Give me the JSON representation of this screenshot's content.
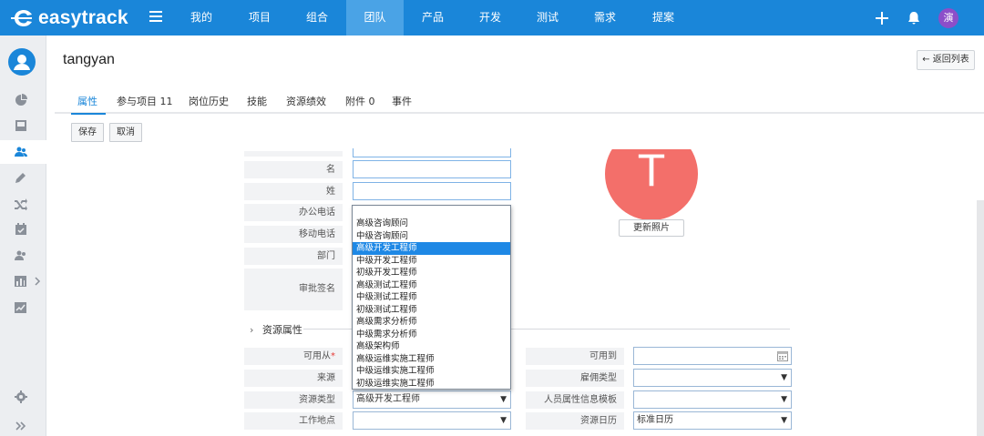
{
  "app": {
    "logo_text": "easytrack"
  },
  "topnav": {
    "items": [
      {
        "label": "我的"
      },
      {
        "label": "项目"
      },
      {
        "label": "组合"
      },
      {
        "label": "团队"
      },
      {
        "label": "产品"
      },
      {
        "label": "开发"
      },
      {
        "label": "测试"
      },
      {
        "label": "需求"
      },
      {
        "label": "提案"
      }
    ],
    "active": "团队",
    "user_avatar": "演"
  },
  "sidebar": {
    "icons": [
      "dashboard-icon",
      "inbox-icon",
      "team-icon",
      "pen-icon",
      "shuffle-icon",
      "calendar-icon",
      "people-icon",
      "chart-icon",
      "trend-icon"
    ],
    "bottom_icons": [
      "settings-icon",
      "expand-icon"
    ]
  },
  "header": {
    "user_name": "tangyan",
    "back_label": "返回列表"
  },
  "tabs": [
    {
      "label": "属性"
    },
    {
      "label": "参与项目 11"
    },
    {
      "label": "岗位历史"
    },
    {
      "label": "技能"
    },
    {
      "label": "资源绩效"
    },
    {
      "label": "附件 0"
    },
    {
      "label": "事件"
    }
  ],
  "actions": {
    "save": "保存",
    "cancel": "取消"
  },
  "form": {
    "labels": {
      "first_name": "名",
      "last_name": "姓",
      "office_phone": "办公电话",
      "mobile_phone": "移动电话",
      "department": "部门",
      "approval_sign": "审批签名"
    },
    "photo_letter": "T",
    "photo_button": "更新照片",
    "resource_section": "资源属性",
    "resource": {
      "available_from": "可用从",
      "available_to": "可用到",
      "source": "来源",
      "employment_type": "雇佣类型",
      "resource_type": "资源类型",
      "resource_type_value": "高级开发工程师",
      "personnel_template": "人员属性信息模板",
      "work_location": "工作地点",
      "resource_calendar": "资源日历",
      "resource_calendar_value": "标准日历"
    }
  },
  "dropdown": {
    "options": [
      "高级咨询顾问",
      "中级咨询顾问",
      "高级开发工程师",
      "中级开发工程师",
      "初级开发工程师",
      "高级测试工程师",
      "中级测试工程师",
      "初级测试工程师",
      "高级需求分析师",
      "中级需求分析师",
      "高级架构师",
      "高级运维实施工程师",
      "中级运维实施工程师",
      "初级运维实施工程师"
    ],
    "selected": "高级开发工程师"
  },
  "colors": {
    "brand": "#1a86d9",
    "required": "#e53935",
    "photo": "#f36f6a"
  }
}
